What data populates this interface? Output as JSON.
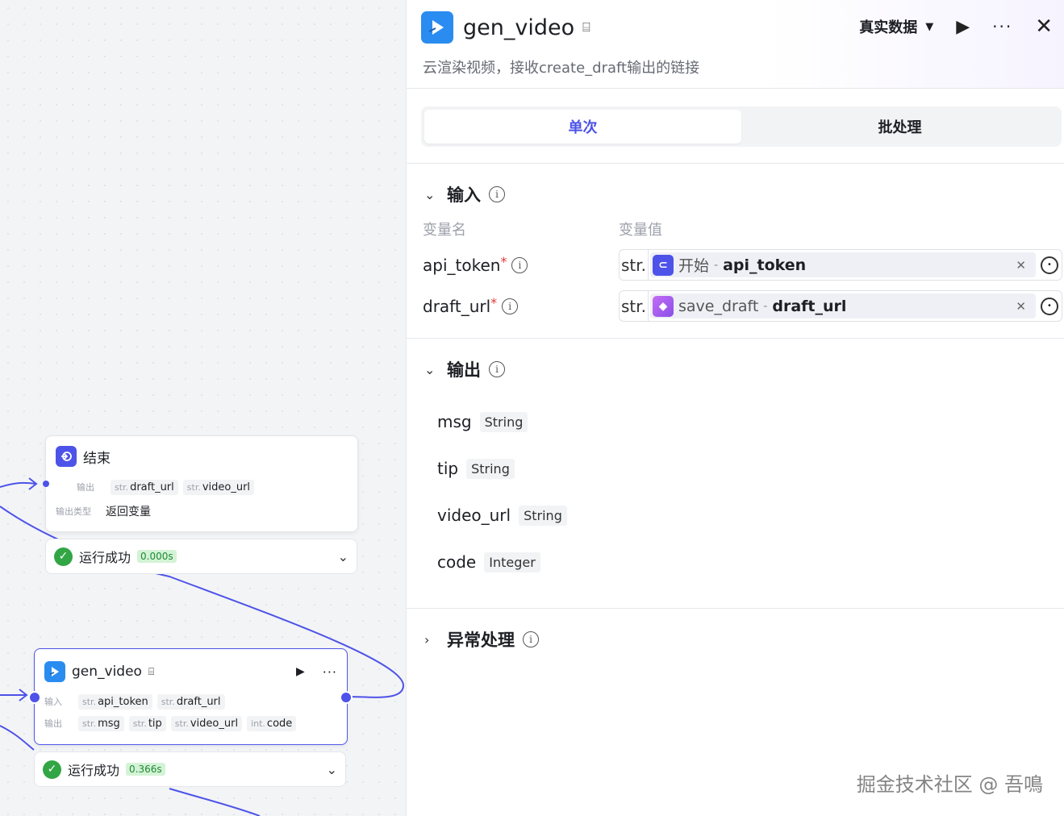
{
  "canvas": {
    "end_node": {
      "title": "结束",
      "output_label": "输出",
      "outputs": [
        {
          "type": "str.",
          "name": "draft_url"
        },
        {
          "type": "str.",
          "name": "video_url"
        }
      ],
      "output_type_label": "输出类型",
      "output_type_value": "返回变量",
      "status": {
        "text": "运行成功",
        "time": "0.000s"
      }
    },
    "gen_node": {
      "title": "gen_video",
      "input_label": "输入",
      "inputs": [
        {
          "type": "str.",
          "name": "api_token"
        },
        {
          "type": "str.",
          "name": "draft_url"
        }
      ],
      "output_label": "输出",
      "outputs": [
        {
          "type": "str.",
          "name": "msg"
        },
        {
          "type": "str.",
          "name": "tip"
        },
        {
          "type": "str.",
          "name": "video_url"
        },
        {
          "type": "int.",
          "name": "code"
        }
      ],
      "status": {
        "text": "运行成功",
        "time": "0.366s"
      }
    }
  },
  "panel": {
    "title": "gen_video",
    "description": "云渲染视频，接收create_draft输出的链接",
    "data_select": "真实数据",
    "tabs": [
      {
        "label": "单次",
        "active": true
      },
      {
        "label": "批处理",
        "active": false
      }
    ],
    "input_section": {
      "title": "输入",
      "col_name": "变量名",
      "col_value": "变量值",
      "rows": [
        {
          "name": "api_token",
          "required_mark": "*",
          "type": "str.",
          "source": "开始",
          "sep": "-",
          "field": "api_token",
          "icon": "start-node-icon"
        },
        {
          "name": "draft_url",
          "required_mark": "*",
          "type": "str.",
          "source": "save_draft",
          "sep": "-",
          "field": "draft_url",
          "icon": "plugin-cube-icon"
        }
      ]
    },
    "output_section": {
      "title": "输出",
      "rows": [
        {
          "name": "msg",
          "type": "String"
        },
        {
          "name": "tip",
          "type": "String"
        },
        {
          "name": "video_url",
          "type": "String"
        },
        {
          "name": "code",
          "type": "Integer"
        }
      ]
    },
    "error_section": {
      "title": "异常处理"
    }
  },
  "watermark": "掘金技术社区 @ 吾鳴",
  "colors": {
    "accent": "#4d53e8",
    "success": "#32a645",
    "plugin_blue": "#2a8cf0"
  }
}
